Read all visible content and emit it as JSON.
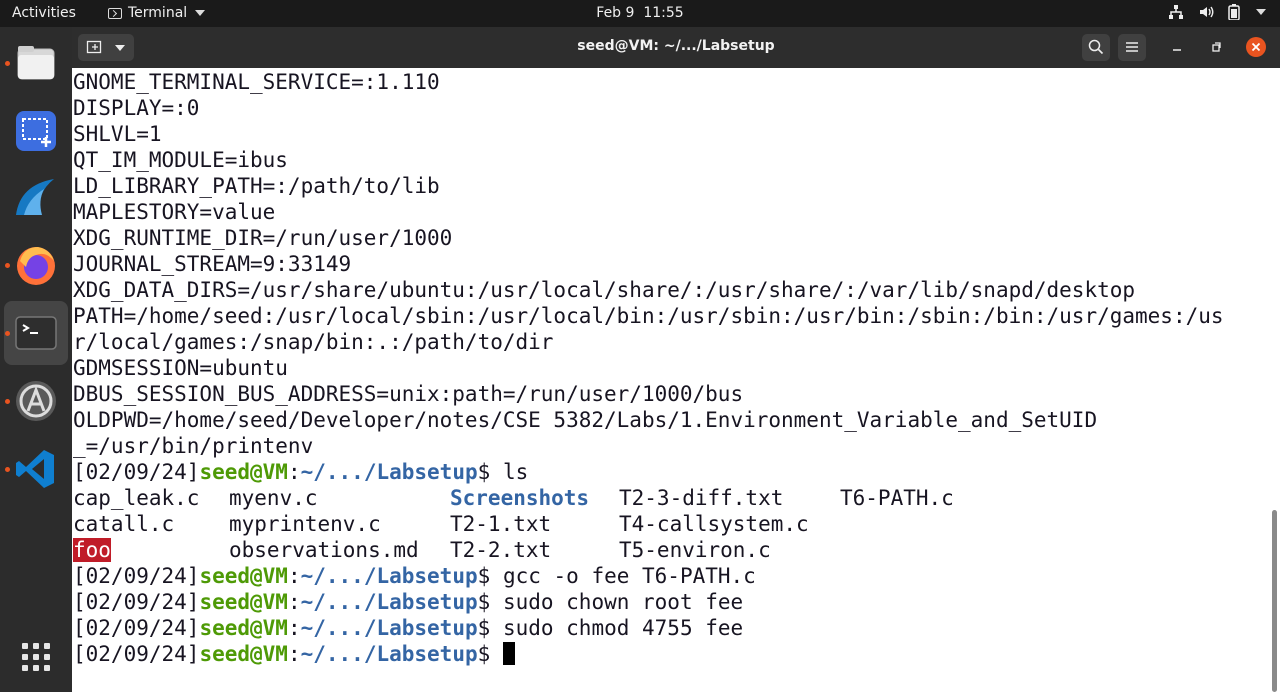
{
  "topbar": {
    "activities": "Activities",
    "app_name": "Terminal",
    "date": "Feb 9",
    "time": "11:55"
  },
  "dock": {
    "items": [
      "files-icon",
      "screenshot-icon",
      "wireshark-icon",
      "firefox-icon",
      "terminal-icon",
      "software-updater-icon",
      "vscode-icon"
    ],
    "active": "terminal-icon",
    "show_apps": "app-grid-icon"
  },
  "window": {
    "title": "seed@VM: ~/.../Labsetup"
  },
  "terminal": {
    "env_lines": [
      "GNOME_TERMINAL_SERVICE=:1.110",
      "DISPLAY=:0",
      "SHLVL=1",
      "QT_IM_MODULE=ibus",
      "LD_LIBRARY_PATH=:/path/to/lib",
      "MAPLESTORY=value",
      "XDG_RUNTIME_DIR=/run/user/1000",
      "JOURNAL_STREAM=9:33149",
      "XDG_DATA_DIRS=/usr/share/ubuntu:/usr/local/share/:/usr/share/:/var/lib/snapd/desktop",
      "PATH=/home/seed:/usr/local/sbin:/usr/local/bin:/usr/sbin:/usr/bin:/sbin:/bin:/usr/games:/us",
      "r/local/games:/snap/bin:.:/path/to/dir",
      "GDMSESSION=ubuntu",
      "DBUS_SESSION_BUS_ADDRESS=unix:path=/run/user/1000/bus",
      "OLDPWD=/home/seed/Developer/notes/CSE 5382/Labs/1.Environment_Variable_and_SetUID",
      "_=/usr/bin/printenv"
    ],
    "prompt": {
      "date": "[02/09/24]",
      "user": "seed@VM",
      "colon": ":",
      "path": "~/.../Labsetup",
      "symbol": "$"
    },
    "commands": [
      "ls",
      "gcc -o fee T6-PATH.c",
      "sudo chown root fee",
      "sudo chmod 4755 fee",
      ""
    ],
    "ls_output": [
      [
        "cap_leak.c",
        "myenv.c",
        "Screenshots",
        "T2-3-diff.txt",
        "T6-PATH.c"
      ],
      [
        "catall.c",
        "myprintenv.c",
        "T2-1.txt",
        "T4-callsystem.c",
        ""
      ],
      [
        "foo",
        "observations.md",
        "T2-2.txt",
        "T5-environ.c",
        ""
      ]
    ]
  }
}
